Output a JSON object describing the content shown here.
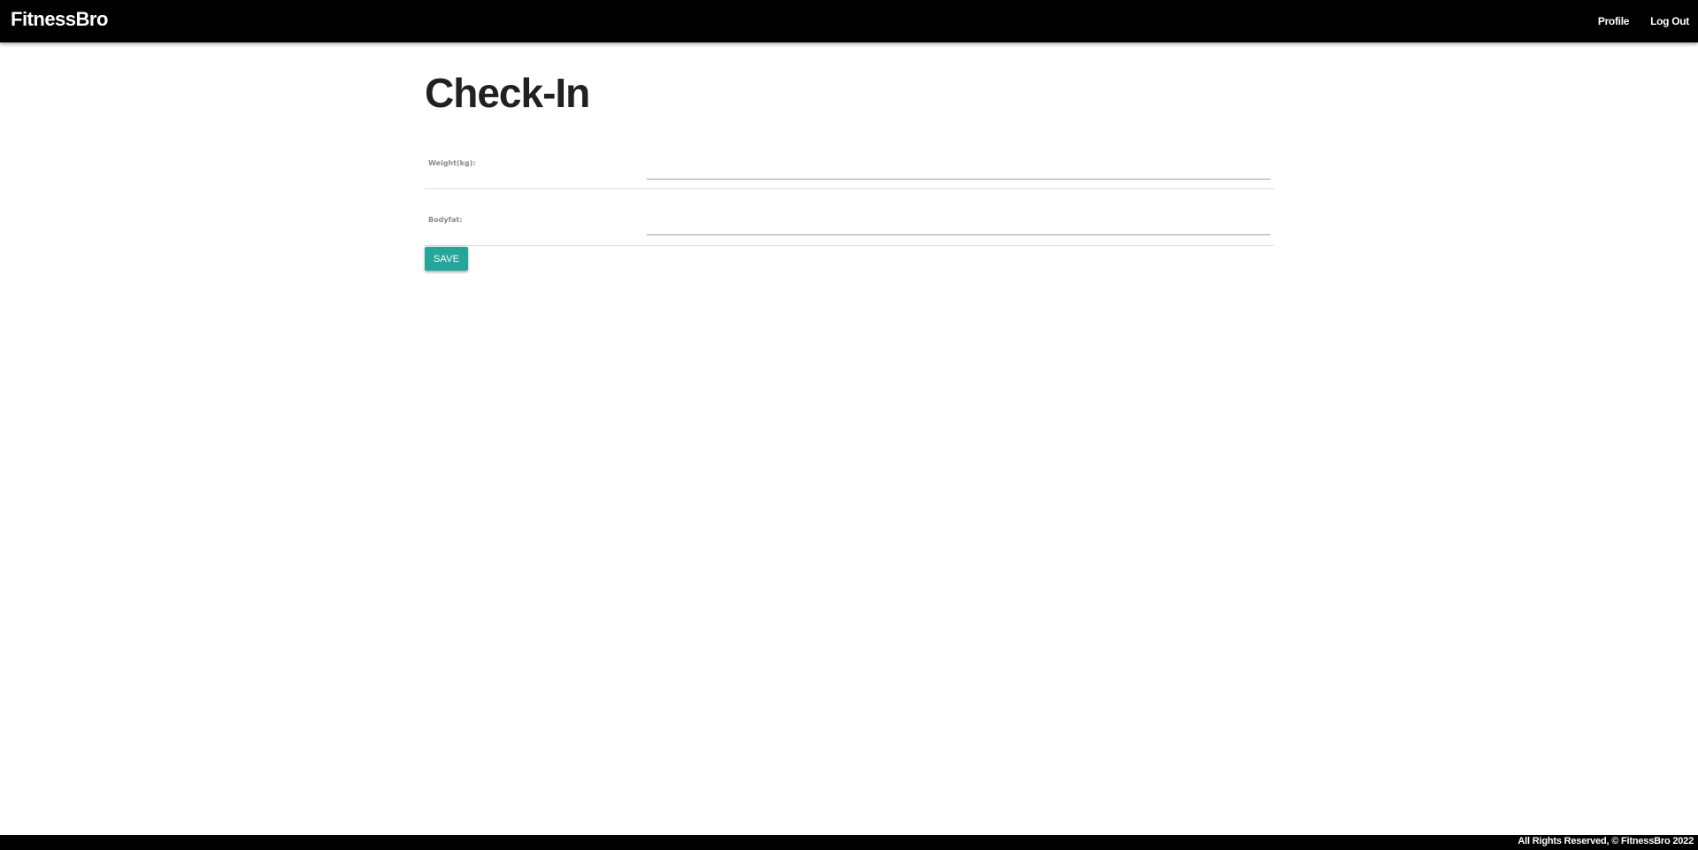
{
  "header": {
    "brand": "FitnessBro",
    "nav": [
      {
        "label": "Profile"
      },
      {
        "label": "Log Out"
      }
    ]
  },
  "page": {
    "title": "Check-In"
  },
  "form": {
    "weight": {
      "label": "Weight(kg):",
      "value": "",
      "placeholder": ""
    },
    "bodyfat": {
      "label": "Bodyfat:",
      "value": "",
      "placeholder": ""
    },
    "save_label": "SAVE"
  },
  "footer": {
    "text": "All Rights Reserved, © FitnessBro 2022"
  },
  "colors": {
    "navbar": "#000000",
    "accent": "#26a69a",
    "footer": "#000000"
  }
}
